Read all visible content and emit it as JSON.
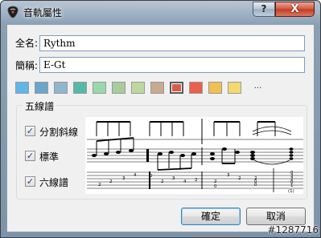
{
  "window": {
    "title": "音軌屬性",
    "help_label": "?",
    "close_label": "X"
  },
  "form": {
    "full_name_label": "全名:",
    "full_name_value": "Rythm",
    "short_name_label": "簡稱:",
    "short_name_value": "E-Gt"
  },
  "colors": {
    "swatches": [
      "#5fb6e8",
      "#6aa6c9",
      "#8fb6cc",
      "#58b8a8",
      "#9ad8ac",
      "#a8cc9e",
      "#bcd8a0",
      "#c8aa90",
      "#d85a4a",
      "#e8604e",
      "#f0c050",
      "#f4d870"
    ],
    "selected_index": 8,
    "more_label": "..."
  },
  "notation": {
    "group_title": "五線譜",
    "options": [
      {
        "label": "分割斜線",
        "checked": true
      },
      {
        "label": "標準",
        "checked": true
      },
      {
        "label": "六線譜",
        "checked": true
      }
    ]
  },
  "tab_numbers": {
    "row1": [
      "2",
      "2",
      "3",
      "4",
      "0"
    ],
    "row2": [
      "2",
      "3",
      "4",
      "2",
      "2",
      "0"
    ],
    "row3": [
      "3",
      "2",
      "2",
      "0",
      "0"
    ],
    "chord": [
      "0",
      "3",
      "2",
      "0",
      "1",
      "(1)"
    ]
  },
  "buttons": {
    "ok_label": "確定",
    "cancel_label": "取消"
  },
  "watermark": "#1287716"
}
